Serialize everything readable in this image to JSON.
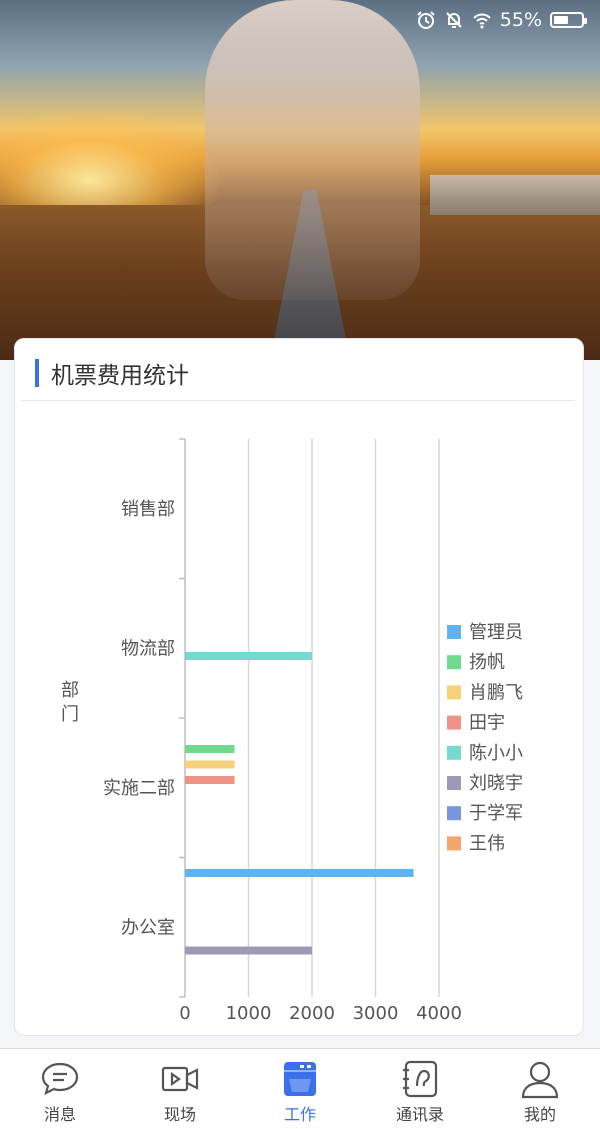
{
  "status_bar": {
    "icons": [
      "alarm-icon",
      "bell-off-icon",
      "wifi-icon",
      "battery-icon"
    ],
    "battery_text": "55%",
    "battery_level": 0.55
  },
  "card": {
    "title": "机票费用统计",
    "accent_color": "#3b71e8"
  },
  "chart_data": {
    "type": "bar",
    "orientation": "horizontal",
    "y_axis_label": "部门",
    "categories": [
      "销售部",
      "物流部",
      "实施二部",
      "办公室"
    ],
    "x_ticks": [
      "0",
      "1000",
      "2000",
      "3000",
      "4000"
    ],
    "xlim": [
      0,
      4000
    ],
    "grid": true,
    "legend_position": "right",
    "series": [
      {
        "name": "管理员",
        "color": "#5fb3f0",
        "values": [
          0,
          0,
          0,
          3600
        ]
      },
      {
        "name": "扬帆",
        "color": "#6fd98c",
        "values": [
          0,
          0,
          780,
          0
        ]
      },
      {
        "name": "肖鹏飞",
        "color": "#f7d07a",
        "values": [
          0,
          0,
          780,
          0
        ]
      },
      {
        "name": "田宇",
        "color": "#ee928a",
        "values": [
          0,
          0,
          780,
          0
        ]
      },
      {
        "name": "陈小小",
        "color": "#76d9d0",
        "values": [
          0,
          2000,
          0,
          0
        ]
      },
      {
        "name": "刘晓宇",
        "color": "#9c9bb5",
        "values": [
          0,
          0,
          0,
          2000
        ]
      },
      {
        "name": "于学军",
        "color": "#7895df",
        "values": [
          0,
          0,
          0,
          0
        ]
      },
      {
        "name": "王伟",
        "color": "#f3a56a",
        "values": [
          0,
          0,
          0,
          0
        ]
      }
    ]
  },
  "tabbar": {
    "items": [
      {
        "label": "消息",
        "icon": "message-icon"
      },
      {
        "label": "现场",
        "icon": "video-icon"
      },
      {
        "label": "工作",
        "icon": "work-icon"
      },
      {
        "label": "通讯录",
        "icon": "contacts-icon"
      },
      {
        "label": "我的",
        "icon": "user-icon"
      }
    ],
    "active_index": 2,
    "active_color": "#3b71e8"
  }
}
